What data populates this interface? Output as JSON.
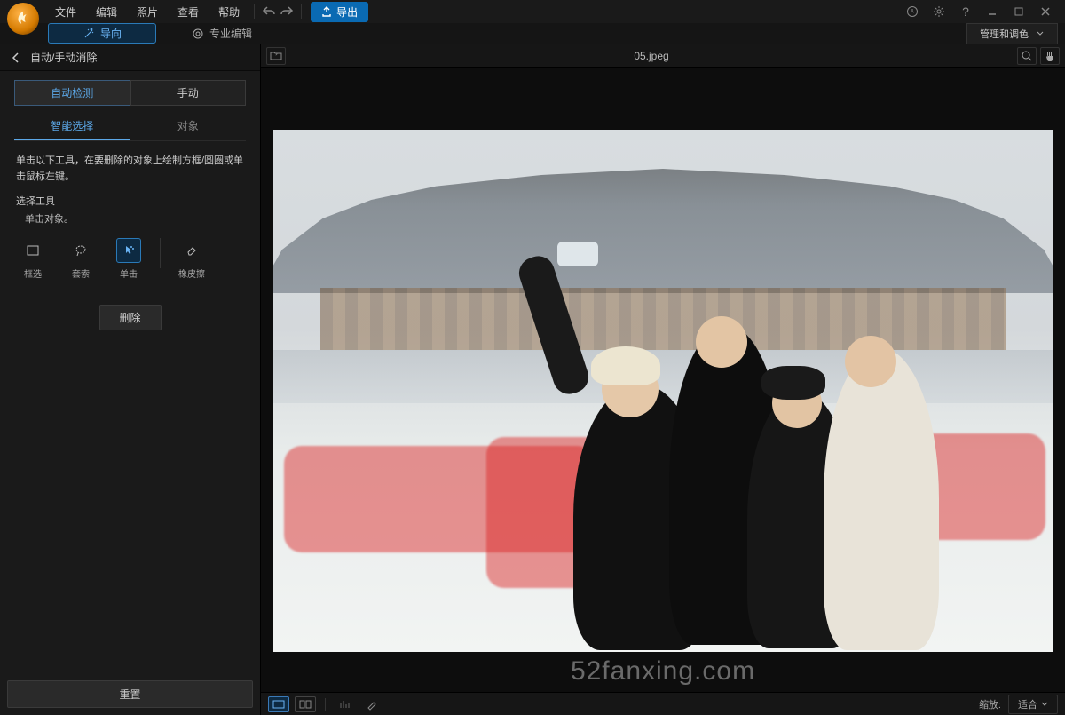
{
  "menu": {
    "file": "文件",
    "edit": "编辑",
    "photo": "照片",
    "view": "查看",
    "help": "帮助"
  },
  "export": "导出",
  "guide": "导向",
  "pro_edit": "专业编辑",
  "manage_color": "管理和调色",
  "panel": {
    "title": "自动/手动消除",
    "tab_auto": "自动检测",
    "tab_manual": "手动",
    "subtab_smart": "智能选择",
    "subtab_object": "对象",
    "instruction": "单击以下工具，在要删除的对象上绘制方框/圆圈或单击鼠标左键。",
    "select_tools": "选择工具",
    "click_object": "单击对象。",
    "tools": {
      "rect": "框选",
      "lasso": "套索",
      "click": "单击",
      "eraser": "橡皮擦"
    },
    "delete": "删除",
    "reset": "重置"
  },
  "filename": "05.jpeg",
  "watermark": "52fanxing.com",
  "zoom": {
    "label": "缩放:",
    "value": "适合"
  }
}
